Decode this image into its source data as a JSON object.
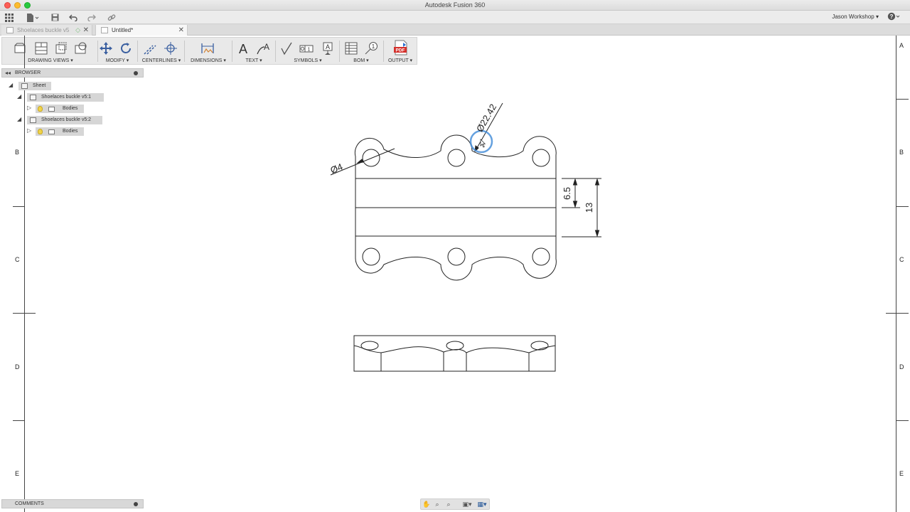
{
  "window": {
    "title": "Autodesk Fusion 360"
  },
  "quickbar": {
    "user": "Jason Workshop",
    "help": "?"
  },
  "tabs": [
    {
      "label": "Shoelaces buckle v5"
    },
    {
      "label": "Untitled*"
    }
  ],
  "toolbar": {
    "groups": [
      {
        "label": "DRAWING VIEWS ▾"
      },
      {
        "label": "MODIFY ▾"
      },
      {
        "label": "CENTERLINES ▾"
      },
      {
        "label": "DIMENSIONS ▾"
      },
      {
        "label": "TEXT ▾"
      },
      {
        "label": "SYMBOLS ▾"
      },
      {
        "label": "BOM ▾"
      },
      {
        "label": "OUTPUT ▾"
      }
    ],
    "pdf_label": "PDF"
  },
  "browser": {
    "title": "BROWSER",
    "sheet": "Sheet",
    "components": [
      {
        "label": "Shoelaces buckle v5:1",
        "child": "Bodies"
      },
      {
        "label": "Shoelaces buckle v5:2",
        "child": "Bodies"
      }
    ]
  },
  "comments": {
    "title": "COMMENTS"
  },
  "zones": {
    "b": "B",
    "c": "C",
    "d": "D",
    "e": "E",
    "a": "A"
  },
  "drawing": {
    "dim_hole": "Ø4",
    "dim_arc": "Ø22.42",
    "dim_half": "6.5",
    "dim_full": "13"
  },
  "colors": {
    "selection": "#4a90d9",
    "line": "#222222"
  }
}
